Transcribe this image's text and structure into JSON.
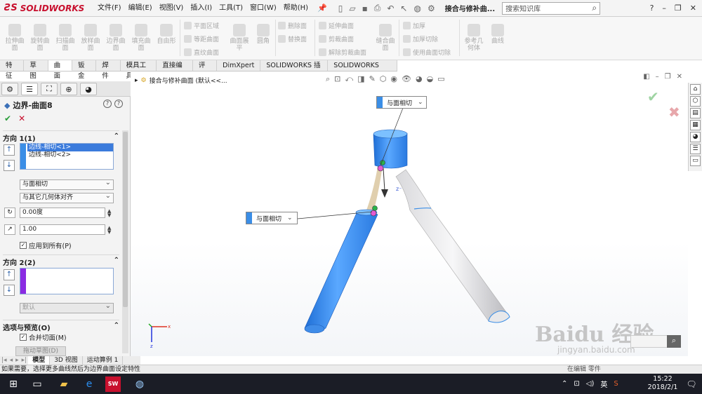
{
  "app": {
    "logo_text": "SOLIDWORKS",
    "menu": [
      "文件(F)",
      "编辑(E)",
      "视图(V)",
      "插入(I)",
      "工具(T)",
      "窗口(W)",
      "帮助(H)"
    ],
    "doc_title": "接合与修补曲...",
    "search_placeholder": "搜索知识库"
  },
  "ribbon": {
    "large": [
      "拉伸曲面",
      "旋转曲面",
      "扫描曲面",
      "放样曲面",
      "边界曲面",
      "填充曲面",
      "自由形"
    ],
    "group2": [
      "平面区域",
      "等距曲面",
      "直纹曲面"
    ],
    "group2_large": "曲面展平",
    "group3_large": "圆角",
    "group4": [
      "删除面",
      "替换面"
    ],
    "group5": [
      "延伸曲面",
      "剪裁曲面",
      "解除剪裁曲面"
    ],
    "group6_large": "缝合曲面",
    "group7": [
      "加厚",
      "加厚切除",
      "使用曲面切除"
    ],
    "group8": [
      "参考几何体",
      "曲线"
    ]
  },
  "tabs": [
    "特征",
    "草图",
    "曲面",
    "钣金",
    "焊件",
    "模具工具",
    "直接编辑",
    "评估",
    "DimXpert",
    "SOLIDWORKS 插件",
    "SOLIDWORKS MBD"
  ],
  "active_tab_index": 2,
  "panel": {
    "title": "边界-曲面8",
    "dir1_label": "方向 1(1)",
    "dir1_items": [
      "边线-相切<1>",
      "边线-相切<2>"
    ],
    "tangency": "与面相切",
    "align": "与其它几何体对齐",
    "angle": "0.00度",
    "length": "1.00",
    "apply_all": "应用到所有(P)",
    "dir2_label": "方向 2(2)",
    "dir2_default": "默认",
    "options_label": "选项与预览(O)",
    "merge_faces": "合并切面(M)",
    "drag_sketch": "拖动草图(D)"
  },
  "viewport": {
    "crumb": "接合与修补曲面 (默认<<...",
    "callout_top": "与面相切",
    "callout_left": "与面相切",
    "watermark": "Baidu 经验",
    "watermark_sub": "jingyan.baidu.com"
  },
  "bottom_tabs": [
    "模型",
    "3D 视图",
    "运动算例 1"
  ],
  "status": {
    "text": "如果需要，选择更多曲线然后为边界曲面设定特性",
    "right": "在编辑 零件"
  },
  "taskbar": {
    "ime": "英",
    "time": "15:22",
    "date": "2018/2/1"
  },
  "colors": {
    "brand_red": "#c8102e",
    "accent_blue": "#3b8ee6",
    "taskbar": "#1b1d26"
  }
}
